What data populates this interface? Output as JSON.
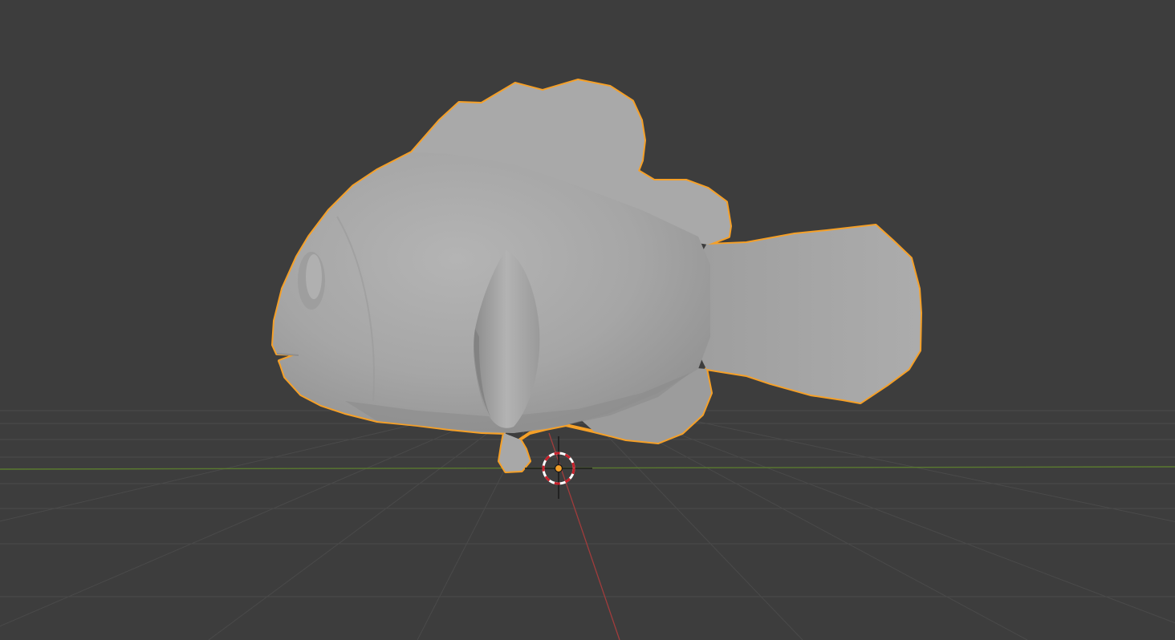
{
  "viewport": {
    "type": "3D viewport",
    "background_color": "#3d3d3d",
    "grid_color": "#4a4a4a",
    "x_axis_color": "#a13c3c",
    "y_axis_color": "#5a7a2f",
    "selection_outline_color": "#f5a028",
    "object_shade_color": "#a6a6a6",
    "object": {
      "icon": "fish-mesh",
      "selected": true
    },
    "cursor_3d": {
      "icon": "3d-cursor-icon"
    },
    "origin": {
      "icon": "object-origin-icon",
      "color": "#f5a028"
    }
  }
}
